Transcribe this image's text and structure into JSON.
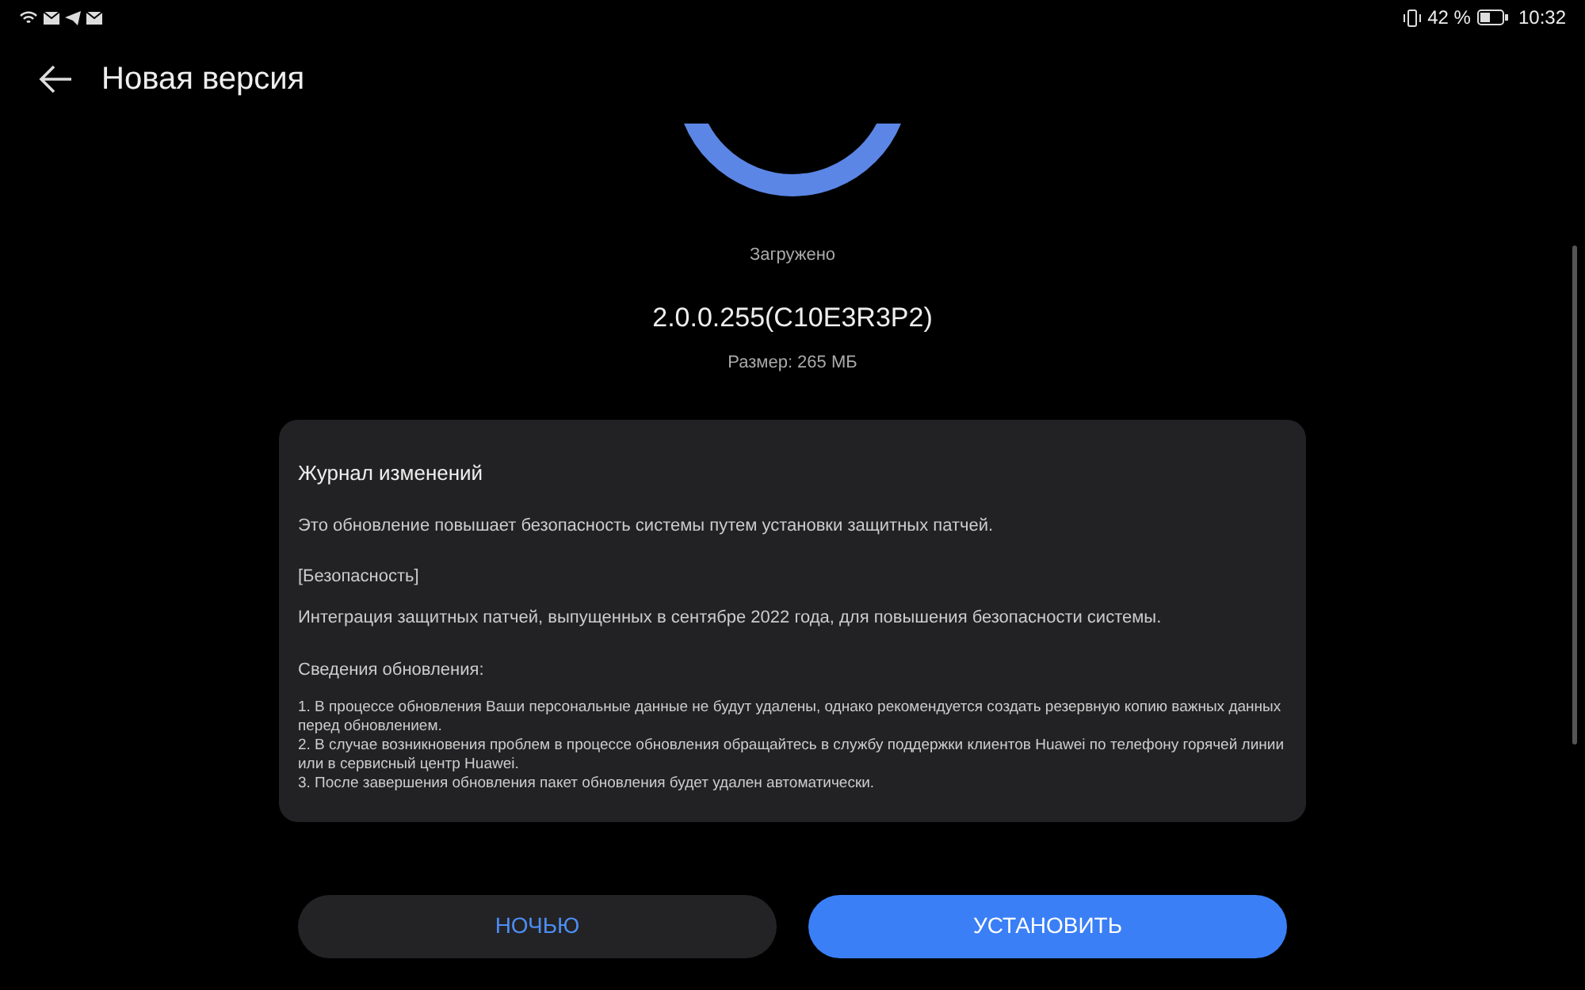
{
  "status_bar": {
    "battery": "42 %",
    "time": "10:32"
  },
  "header": {
    "title": "Новая версия"
  },
  "download": {
    "status": "Загружено",
    "version": "2.0.0.255(C10E3R3P2)",
    "size": "Размер: 265 МБ"
  },
  "changelog": {
    "title": "Журнал изменений",
    "summary": "Это обновление повышает безопасность системы путем установки защитных патчей.",
    "section": "[Безопасность]",
    "section_text": "Интеграция защитных патчей, выпущенных в сентябре 2022 года, для повышения безопасности системы.",
    "notes_title": "Сведения обновления:",
    "notes": [
      "1. В процессе обновления Ваши персональные данные не будут удалены, однако рекомендуется создать резервную копию важных данных перед обновлением.",
      "2. В случае возникновения проблем в процессе обновления обращайтесь в службу поддержки клиентов Huawei по телефону горячей линии или в сервисный центр Huawei.",
      "3. После завершения обновления пакет обновления будет удален автоматически."
    ]
  },
  "buttons": [
    {
      "label": "НОЧЬЮ",
      "kind": "secondary"
    },
    {
      "label": "УСТАНОВИТЬ",
      "kind": "primary"
    }
  ]
}
